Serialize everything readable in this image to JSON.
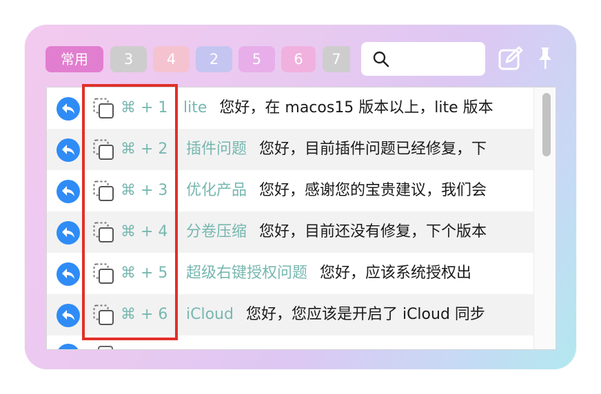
{
  "tabs": [
    {
      "label": "常用"
    },
    {
      "label": "3"
    },
    {
      "label": "4"
    },
    {
      "label": "2"
    },
    {
      "label": "5"
    },
    {
      "label": "6"
    },
    {
      "label": "7"
    }
  ],
  "toolbar": {
    "search_placeholder": "",
    "search_icon": "search-icon",
    "edit_icon": "edit-icon",
    "pin_icon": "pin-icon"
  },
  "rows": [
    {
      "shortcut": "⌘ + 1",
      "title": "lite",
      "body": "您好，在 macos15 版本以上，lite 版本"
    },
    {
      "shortcut": "⌘ + 2",
      "title": "插件问题",
      "body": "您好，目前插件问题已经修复，下"
    },
    {
      "shortcut": "⌘ + 3",
      "title": "优化产品",
      "body": "您好，感谢您的宝贵建议，我们会"
    },
    {
      "shortcut": "⌘ + 4",
      "title": "分卷压缩",
      "body": "您好，目前还没有修复，下个版本"
    },
    {
      "shortcut": "⌘ + 5",
      "title": "超级右键授权问题",
      "body": "您好，应该系统授权出"
    },
    {
      "shortcut": "⌘ + 6",
      "title": "iCloud",
      "body": "您好，您应该是开启了 iCloud 同步"
    }
  ],
  "colors": {
    "accent_blue": "#2f8cf6",
    "title_teal": "#77b7b0",
    "highlight_red": "#e0302a"
  }
}
